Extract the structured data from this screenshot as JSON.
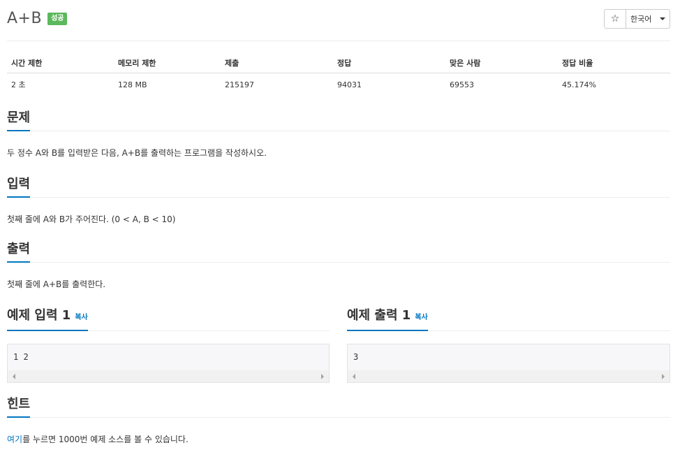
{
  "problem": {
    "title": "A+B",
    "badge": "성공"
  },
  "toolbar": {
    "star_icon": "☆",
    "language": "한국어"
  },
  "info_table": {
    "headers": [
      "시간 제한",
      "메모리 제한",
      "제출",
      "정답",
      "맞은 사람",
      "정답 비율"
    ],
    "values": [
      "2 초",
      "128 MB",
      "215197",
      "94031",
      "69553",
      "45.174%"
    ]
  },
  "sections": {
    "problem": {
      "title": "문제",
      "body": "두 정수 A와 B를 입력받은 다음, A+B를 출력하는 프로그램을 작성하시오."
    },
    "input": {
      "title": "입력",
      "body": "첫째 줄에 A와 B가 주어진다. (0 < A, B < 10)"
    },
    "output": {
      "title": "출력",
      "body": "첫째 줄에 A+B를 출력한다."
    },
    "sample_input": {
      "title": "예제 입력 1",
      "copy": "복사",
      "content": "1 2"
    },
    "sample_output": {
      "title": "예제 출력 1",
      "copy": "복사",
      "content": "3"
    },
    "hint": {
      "title": "힌트",
      "link_text": "여기",
      "body_rest": "를 누르면 1000번 예제 소스를 볼 수 있습니다."
    }
  }
}
